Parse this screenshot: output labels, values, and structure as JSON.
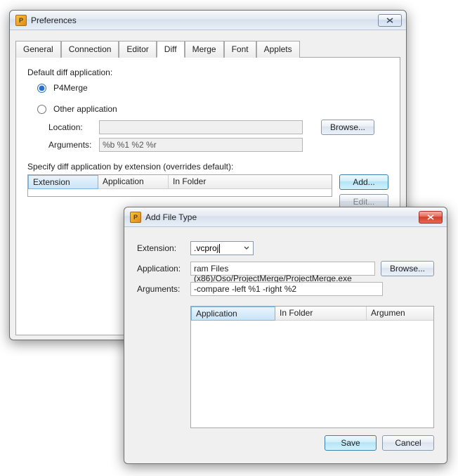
{
  "prefs": {
    "title": "Preferences",
    "tabs": [
      "General",
      "Connection",
      "Editor",
      "Diff",
      "Merge",
      "Font",
      "Applets"
    ],
    "active_tab": 3,
    "diff": {
      "heading": "Default diff application:",
      "p4merge_label": "P4Merge",
      "other_label": "Other application",
      "selected": "p4merge",
      "location_label": "Location:",
      "location_value": "",
      "arguments_label": "Arguments:",
      "arguments_value": "%b %1 %2 %r",
      "browse_label": "Browse...",
      "override_label": "Specify diff application by extension (overrides default):",
      "grid_headers": [
        "Extension",
        "Application",
        "In Folder"
      ],
      "add_label": "Add...",
      "edit_label": "Edit..."
    }
  },
  "aft": {
    "title": "Add File Type",
    "extension_label": "Extension:",
    "extension_value": ".vcproj",
    "application_label": "Application:",
    "application_value": "ram Files (x86)/Oso/ProjectMerge/ProjectMerge.exe",
    "browse_label": "Browse...",
    "arguments_label": "Arguments:",
    "arguments_value": "-compare -left %1 -right %2",
    "list_headers": [
      "Application",
      "In Folder",
      "Argumen"
    ],
    "save_label": "Save",
    "cancel_label": "Cancel"
  }
}
